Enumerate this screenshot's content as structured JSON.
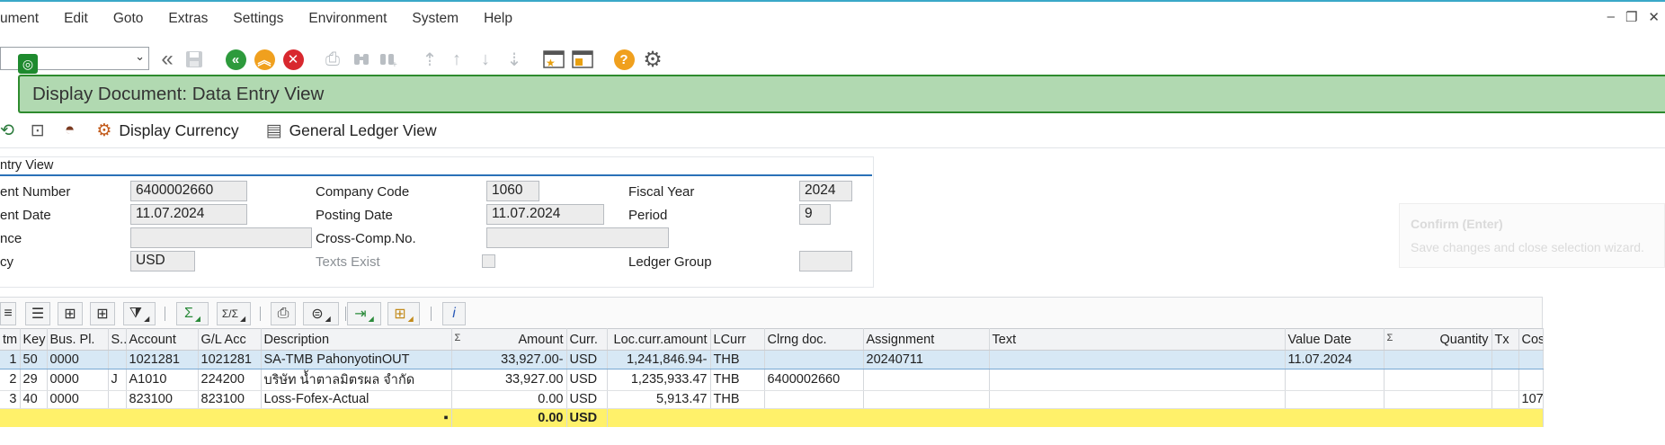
{
  "menu": [
    "ument",
    "Edit",
    "Goto",
    "Extras",
    "Settings",
    "Environment",
    "System",
    "Help"
  ],
  "window_controls": [
    "–",
    "❐",
    "✕"
  ],
  "title": "Display Document: Data Entry View",
  "app_toolbar": {
    "display_currency": "Display Currency",
    "general_ledger_view": "General Ledger View"
  },
  "header": {
    "section_title": "ntry View",
    "doc_number_label": "ent Number",
    "doc_number": "6400002660",
    "doc_date_label": "ent Date",
    "doc_date": "11.07.2024",
    "reference_label": "nce",
    "reference": "",
    "currency_label": "cy",
    "currency": "USD",
    "company_code_label": "Company Code",
    "company_code": "1060",
    "posting_date_label": "Posting Date",
    "posting_date": "11.07.2024",
    "cross_comp_label": "Cross-Comp.No.",
    "cross_comp": "",
    "texts_exist_label": "Texts Exist",
    "fiscal_year_label": "Fiscal Year",
    "fiscal_year": "2024",
    "period_label": "Period",
    "period": "9",
    "ledger_group_label": "Ledger Group",
    "ledger_group": ""
  },
  "tooltip": {
    "title": "Confirm (Enter)",
    "text": "Save changes and close selection wizard."
  },
  "grid": {
    "columns": {
      "itm": "tm",
      "key": "Key",
      "bus": "Bus. Pl.",
      "s": "S...",
      "account": "Account",
      "gl": "G/L Acc",
      "desc": "Description",
      "amount": "Amount",
      "curr": "Curr.",
      "loc": "Loc.curr.amount",
      "lcurr": "LCurr",
      "clrng": "Clrng doc.",
      "assign": "Assignment",
      "text": "Text",
      "vdate": "Value Date",
      "qty": "Quantity",
      "tx": "Tx",
      "cos": "Cos"
    },
    "rows": [
      {
        "itm": "1",
        "key": "50",
        "bus": "0000",
        "s": "",
        "account": "1021281",
        "gl": "1021281",
        "desc": "SA-TMB PahonyotinOUT",
        "amount": "33,927.00-",
        "curr": "USD",
        "loc": "1,241,846.94-",
        "lcurr": "THB",
        "clrng": "",
        "assign": "20240711",
        "text": "",
        "vdate": "11.07.2024",
        "qty": "",
        "tx": "",
        "cos": ""
      },
      {
        "itm": "2",
        "key": "29",
        "bus": "0000",
        "s": "J",
        "account": "A1010",
        "gl": "224200",
        "desc": "บริษัท น้ำตาลมิตรผล จำกัด",
        "amount": "33,927.00",
        "curr": "USD",
        "loc": "1,235,933.47",
        "lcurr": "THB",
        "clrng": "6400002660",
        "assign": "",
        "text": "",
        "vdate": "",
        "qty": "",
        "tx": "",
        "cos": ""
      },
      {
        "itm": "3",
        "key": "40",
        "bus": "0000",
        "s": "",
        "account": "823100",
        "gl": "823100",
        "desc": "Loss-Fofex-Actual",
        "amount": "0.00",
        "curr": "USD",
        "loc": "5,913.47",
        "lcurr": "THB",
        "clrng": "",
        "assign": "",
        "text": "",
        "vdate": "",
        "qty": "",
        "tx": "",
        "cos": "107"
      }
    ],
    "total": {
      "marker": "▪",
      "amount": "0.00",
      "curr": "USD"
    }
  },
  "colors": {
    "banner_bg": "#b1d9b1",
    "banner_border": "#2e8b2e",
    "total_row": "#fff16a",
    "selected_row": "#d7e8f5"
  }
}
